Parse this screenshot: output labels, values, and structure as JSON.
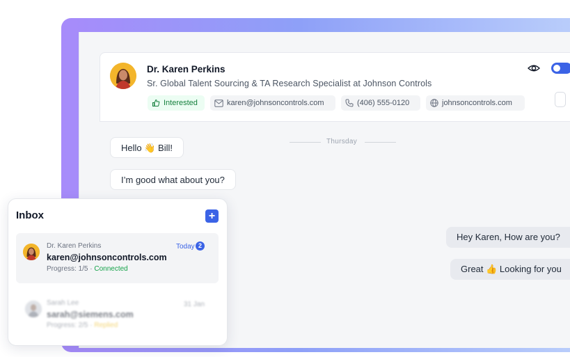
{
  "contact": {
    "name": "Dr. Karen Perkins",
    "title": "Sr. Global Talent Sourcing & TA Research Specialist at Johnson Controls",
    "status": "Interested",
    "email": "karen@johnsoncontrols.com",
    "phone": "(406) 555-0120",
    "website": "johnsoncontrols.com"
  },
  "chat": {
    "day_divider": "Thursday",
    "messages": [
      {
        "direction": "in",
        "text": "Hello 👋 Bill!"
      },
      {
        "direction": "in",
        "text": "I’m good what about you?"
      },
      {
        "direction": "out",
        "text": "Hey Karen, How are you?"
      },
      {
        "direction": "out",
        "text": "Great 👍 Looking for you"
      }
    ]
  },
  "inbox": {
    "title": "Inbox",
    "add_label": "+",
    "items": [
      {
        "name": "Dr. Karen Perkins",
        "email": "karen@johnsoncontrols.com",
        "progress": "Progress: 1/5 · ",
        "status": "Connected",
        "date": "Today",
        "unread": "2"
      },
      {
        "name": "Sarah Lee",
        "email": "sarah@siemens.com",
        "progress": "Progress: 2/5 · ",
        "status": "Replied",
        "date": "31 Jan"
      }
    ]
  },
  "colors": {
    "accent": "#3b63e6",
    "interested": "#15803d",
    "connected": "#16a34a",
    "replied": "#eab308"
  }
}
